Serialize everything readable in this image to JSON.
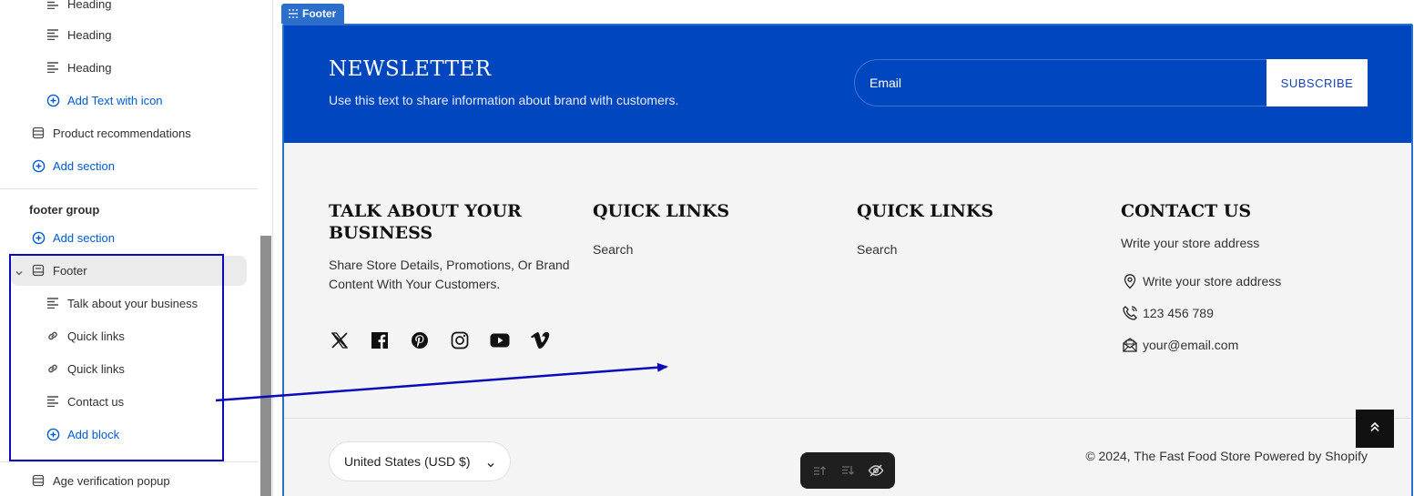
{
  "sidebar": {
    "items": [
      {
        "label": "Heading",
        "icon": "text-lines-icon"
      },
      {
        "label": "Heading",
        "icon": "text-lines-icon"
      },
      {
        "label": "Heading",
        "icon": "text-lines-icon"
      },
      {
        "label": "Add Text with icon",
        "icon": "plus-circle-icon"
      },
      {
        "label": "Product recommendations",
        "icon": "section-icon"
      },
      {
        "label": "Add section",
        "icon": "plus-circle-icon"
      }
    ],
    "footer_group": {
      "title": "footer group",
      "add_section": "Add section",
      "footer": "Footer",
      "blocks": [
        {
          "label": "Talk about your business",
          "icon": "text-lines-icon"
        },
        {
          "label": "Quick links",
          "icon": "link-icon"
        },
        {
          "label": "Quick links",
          "icon": "link-icon"
        },
        {
          "label": "Contact us",
          "icon": "text-lines-icon"
        }
      ],
      "add_block": "Add block"
    },
    "age_popup": "Age verification popup"
  },
  "preview": {
    "footer_tag": "Footer",
    "newsletter": {
      "title": "NEWSLETTER",
      "text": "Use this text to share information about brand with customers.",
      "email_placeholder": "Email",
      "subscribe": "SUBSCRIBE"
    },
    "columns": {
      "business_title": "TALK ABOUT YOUR BUSINESS",
      "business_text": "Share Store Details, Promotions, Or Brand Content With Your Customers.",
      "quick1_title": "QUICK LINKS",
      "quick1_link": "Search",
      "quick2_title": "QUICK LINKS",
      "quick2_link": "Search",
      "contact_title": "CONTACT US",
      "contact_text": "Write your store address",
      "contact_address": "Write your store address",
      "contact_phone": "123 456 789",
      "contact_email": "your@email.com"
    },
    "social": [
      "x-icon",
      "facebook-icon",
      "pinterest-icon",
      "instagram-icon",
      "youtube-icon",
      "vimeo-icon"
    ],
    "currency": "United States (USD $)",
    "copyright": "© 2024, The Fast Food Store Powered by Shopify"
  },
  "colors": {
    "newsletter_bg": "#0047bf",
    "accent": "#005bd3",
    "selection": "#2c6ecb",
    "annotation": "#0a0ab8"
  }
}
